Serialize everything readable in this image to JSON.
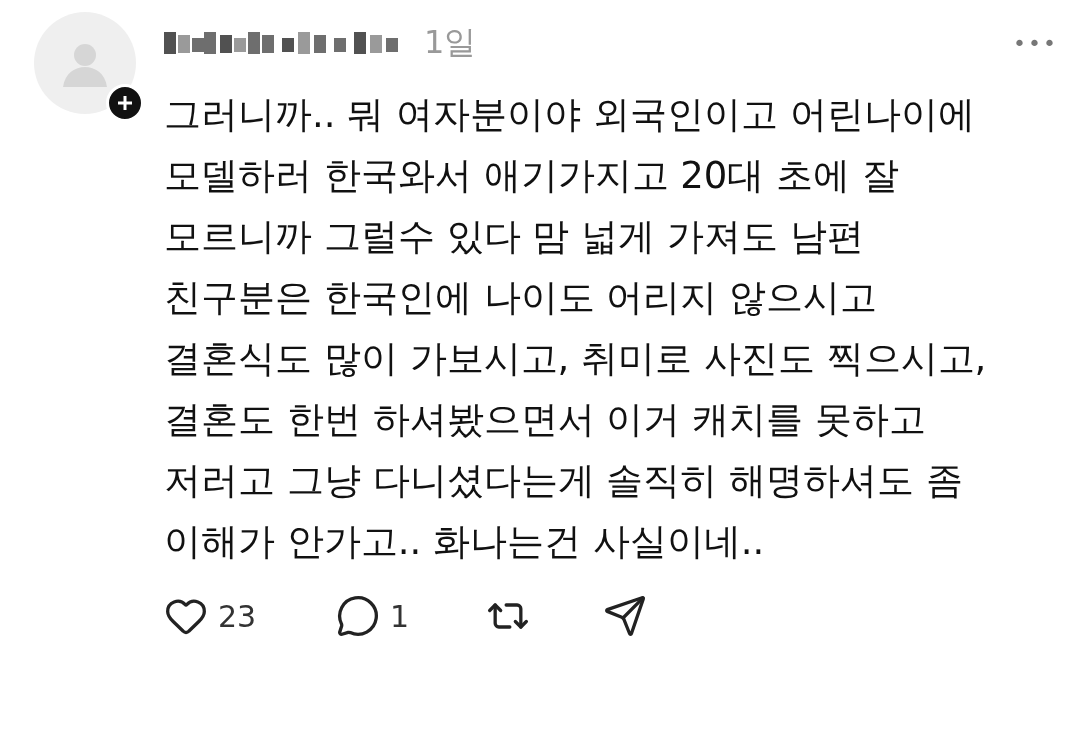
{
  "post": {
    "time": "1일",
    "more": "•••",
    "text": "그러니까.. 뭐 여자분이야 외국인이고 어린나이에\n모델하러 한국와서 애기가지고 20대 초에 잘\n모르니까 그럴수 있다 맘 넓게 가져도 남편\n친구분은 한국인에 나이도 어리지 않으시고\n결혼식도 많이 가보시고, 취미로 사진도 찍으시고,\n결혼도 한번 하셔봤으면서 이거 캐치를 못하고\n저러고 그냥 다니셨다는게 솔직히 해명하셔도 좀\n이해가 안가고.. 화나는건 사실이네..",
    "actions": [
      {
        "kind": "like",
        "count": "23"
      },
      {
        "kind": "reply",
        "count": "1"
      },
      {
        "kind": "repost"
      },
      {
        "kind": "share"
      }
    ]
  }
}
